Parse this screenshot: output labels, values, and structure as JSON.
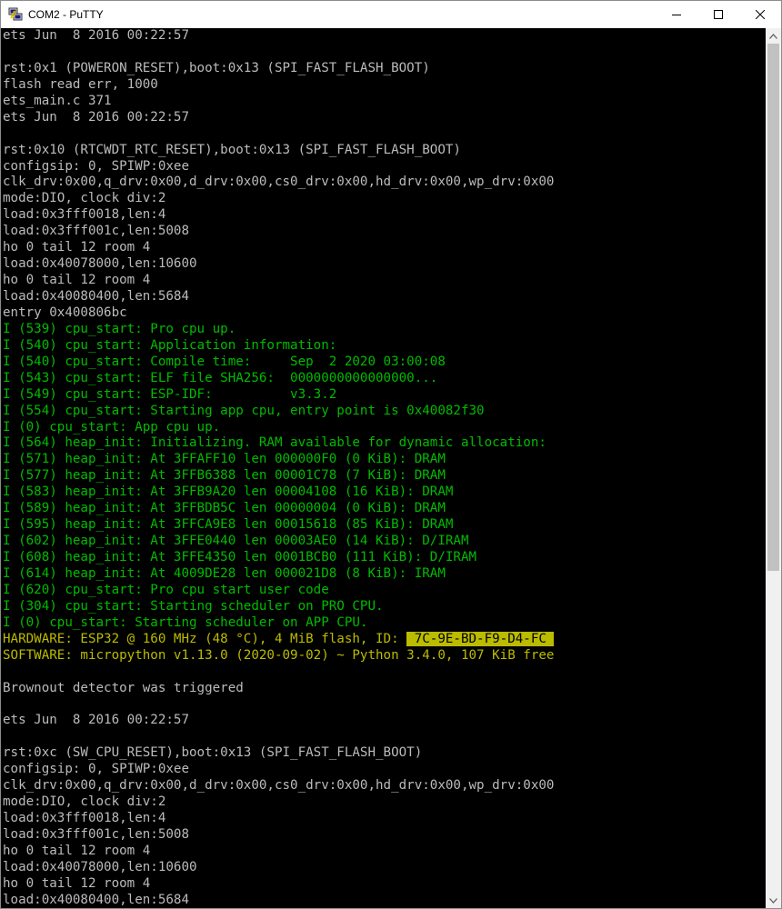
{
  "window": {
    "title": "COM2 - PuTTY",
    "icon": "putty-icon",
    "controls": [
      "minimize-icon",
      "maximize-icon",
      "close-icon"
    ]
  },
  "colors": {
    "terminal_bg": "#000000",
    "default_text": "#bbbbbb",
    "log_info": "#00bb00",
    "highlight": "#bbbb00"
  },
  "terminal": {
    "lines": [
      {
        "text": "ets Jun  8 2016 00:22:57",
        "color": "gray"
      },
      {
        "text": "",
        "color": "gray"
      },
      {
        "text": "rst:0x1 (POWERON_RESET),boot:0x13 (SPI_FAST_FLASH_BOOT)",
        "color": "gray"
      },
      {
        "text": "flash read err, 1000",
        "color": "gray"
      },
      {
        "text": "ets_main.c 371",
        "color": "gray"
      },
      {
        "text": "ets Jun  8 2016 00:22:57",
        "color": "gray"
      },
      {
        "text": "",
        "color": "gray"
      },
      {
        "text": "rst:0x10 (RTCWDT_RTC_RESET),boot:0x13 (SPI_FAST_FLASH_BOOT)",
        "color": "gray"
      },
      {
        "text": "configsip: 0, SPIWP:0xee",
        "color": "gray"
      },
      {
        "text": "clk_drv:0x00,q_drv:0x00,d_drv:0x00,cs0_drv:0x00,hd_drv:0x00,wp_drv:0x00",
        "color": "gray"
      },
      {
        "text": "mode:DIO, clock div:2",
        "color": "gray"
      },
      {
        "text": "load:0x3fff0018,len:4",
        "color": "gray"
      },
      {
        "text": "load:0x3fff001c,len:5008",
        "color": "gray"
      },
      {
        "text": "ho 0 tail 12 room 4",
        "color": "gray"
      },
      {
        "text": "load:0x40078000,len:10600",
        "color": "gray"
      },
      {
        "text": "ho 0 tail 12 room 4",
        "color": "gray"
      },
      {
        "text": "load:0x40080400,len:5684",
        "color": "gray"
      },
      {
        "text": "entry 0x400806bc",
        "color": "gray"
      },
      {
        "text": "I (539) cpu_start: Pro cpu up.",
        "color": "green"
      },
      {
        "text": "I (540) cpu_start: Application information:",
        "color": "green"
      },
      {
        "text": "I (540) cpu_start: Compile time:     Sep  2 2020 03:00:08",
        "color": "green"
      },
      {
        "text": "I (543) cpu_start: ELF file SHA256:  0000000000000000...",
        "color": "green"
      },
      {
        "text": "I (549) cpu_start: ESP-IDF:          v3.3.2",
        "color": "green"
      },
      {
        "text": "I (554) cpu_start: Starting app cpu, entry point is 0x40082f30",
        "color": "green"
      },
      {
        "text": "I (0) cpu_start: App cpu up.",
        "color": "green"
      },
      {
        "text": "I (564) heap_init: Initializing. RAM available for dynamic allocation:",
        "color": "green"
      },
      {
        "text": "I (571) heap_init: At 3FFAFF10 len 000000F0 (0 KiB): DRAM",
        "color": "green"
      },
      {
        "text": "I (577) heap_init: At 3FFB6388 len 00001C78 (7 KiB): DRAM",
        "color": "green"
      },
      {
        "text": "I (583) heap_init: At 3FFB9A20 len 00004108 (16 KiB): DRAM",
        "color": "green"
      },
      {
        "text": "I (589) heap_init: At 3FFBDB5C len 00000004 (0 KiB): DRAM",
        "color": "green"
      },
      {
        "text": "I (595) heap_init: At 3FFCA9E8 len 00015618 (85 KiB): DRAM",
        "color": "green"
      },
      {
        "text": "I (602) heap_init: At 3FFE0440 len 00003AE0 (14 KiB): D/IRAM",
        "color": "green"
      },
      {
        "text": "I (608) heap_init: At 3FFE4350 len 0001BCB0 (111 KiB): D/IRAM",
        "color": "green"
      },
      {
        "text": "I (614) heap_init: At 4009DE28 len 000021D8 (8 KiB): IRAM",
        "color": "green"
      },
      {
        "text": "I (620) cpu_start: Pro cpu start user code",
        "color": "green"
      },
      {
        "text": "I (304) cpu_start: Starting scheduler on PRO CPU.",
        "color": "green"
      },
      {
        "text": "I (0) cpu_start: Starting scheduler on APP CPU.",
        "color": "green"
      },
      {
        "text": "HARDWARE: ESP32 @ 160 MHz (48 °C), 4 MiB flash, ID: ",
        "color": "yellow",
        "highlight": " 7C-9E-BD-F9-D4-FC "
      },
      {
        "text": "SOFTWARE: micropython v1.13.0 (2020-09-02) ~ Python 3.4.0, 107 KiB free",
        "color": "yellow"
      },
      {
        "text": "",
        "color": "gray"
      },
      {
        "text": "Brownout detector was triggered",
        "color": "gray"
      },
      {
        "text": "",
        "color": "gray"
      },
      {
        "text": "ets Jun  8 2016 00:22:57",
        "color": "gray"
      },
      {
        "text": "",
        "color": "gray"
      },
      {
        "text": "rst:0xc (SW_CPU_RESET),boot:0x13 (SPI_FAST_FLASH_BOOT)",
        "color": "gray"
      },
      {
        "text": "configsip: 0, SPIWP:0xee",
        "color": "gray"
      },
      {
        "text": "clk_drv:0x00,q_drv:0x00,d_drv:0x00,cs0_drv:0x00,hd_drv:0x00,wp_drv:0x00",
        "color": "gray"
      },
      {
        "text": "mode:DIO, clock div:2",
        "color": "gray"
      },
      {
        "text": "load:0x3fff0018,len:4",
        "color": "gray"
      },
      {
        "text": "load:0x3fff001c,len:5008",
        "color": "gray"
      },
      {
        "text": "ho 0 tail 12 room 4",
        "color": "gray"
      },
      {
        "text": "load:0x40078000,len:10600",
        "color": "gray"
      },
      {
        "text": "ho 0 tail 12 room 4",
        "color": "gray"
      },
      {
        "text": "load:0x40080400,len:5684",
        "color": "gray"
      }
    ]
  }
}
